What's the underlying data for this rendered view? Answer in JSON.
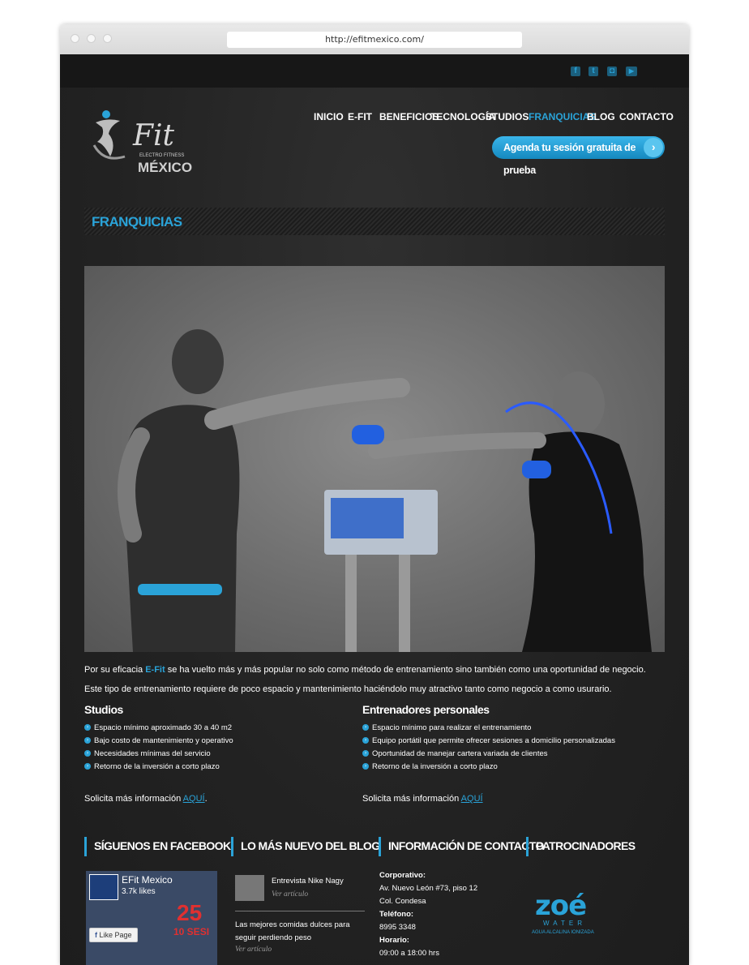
{
  "browser": {
    "url": "http://efitmexico.com/"
  },
  "social": [
    "facebook-icon",
    "twitter-icon",
    "instagram-icon",
    "youtube-icon"
  ],
  "logo": {
    "brand": "Fit",
    "tagline": "ELECTRO FITNESS",
    "country": "MÉXICO"
  },
  "nav": {
    "items": [
      "INICIO",
      "E-FIT",
      "BENEFICIOS",
      "TECNOLOGÍA",
      "STUDIOS",
      "FRANQUICIAS",
      "BLOG",
      "CONTACTO"
    ],
    "active": "FRANQUICIAS"
  },
  "cta": {
    "label": "Agenda tu sesión gratuita de prueba"
  },
  "page": {
    "title": "FRANQUICIAS"
  },
  "intro": {
    "p1_before": "Por su eficacia ",
    "p1_brand": "E-Fit",
    "p1_after": " se ha vuelto más y más popular no solo como método de entrenamiento sino también como una oportunidad de negocio.",
    "p2": "Este tipo de entrenamiento requiere de poco espacio y mantenimiento haciéndolo muy atractivo tanto como negocio a como usurario."
  },
  "studios": {
    "heading": "Studios",
    "items": [
      "Espacio mínimo aproximado 30 a 40 m2",
      "Bajo costo de mantenimiento y operativo",
      "Necesidades mínimas del servicio",
      "Retorno de la inversión a corto plazo"
    ],
    "info_text": "Solicita más información ",
    "info_link": "AQUÍ",
    "info_end": "."
  },
  "trainers": {
    "heading": "Entrenadores personales",
    "items": [
      "Espacio mínimo para realizar el entrenamiento",
      "Equipo portátil que permite ofrecer sesiones a domicilio personalizadas",
      "Oportunidad de manejar cartera variada de clientes",
      "Retorno de la inversión a corto plazo"
    ],
    "info_text": "Solicita más información ",
    "info_link": "AQUÍ"
  },
  "footer": {
    "facebook": {
      "heading": "SÍGUENOS EN FACEBOOK",
      "page_name": "EFit Mexico",
      "likes": "3.7k likes",
      "like_button": "Like Page",
      "promo": "25",
      "promo2": "10 SESI"
    },
    "blog": {
      "heading": "LO MÁS NUEVO DEL BLOG",
      "posts": [
        {
          "title": "Entrevista Nike Nagy",
          "link": "Ver artículo"
        },
        {
          "title": "Las mejores comidas dulces para seguir perdiendo peso",
          "link": "Ver artículo"
        }
      ]
    },
    "contact": {
      "heading": "INFORMACIÓN DE CONTACTO",
      "corp_label": "Corporativo:",
      "address1": "Av. Nuevo León #73, piso 12",
      "address2": "Col. Condesa",
      "phone_label": "Teléfono:",
      "phone": "8995 3348",
      "hours_label": "Horario:",
      "hours": "09:00 a 18:00 hrs"
    },
    "sponsors": {
      "heading": "PATROCINADORES",
      "sponsor_name": "zoé",
      "sponsor_sub": "WATER",
      "sponsor_tag": "AGUA ALCALINA IONIZADA"
    }
  },
  "colors": {
    "accent": "#2aa3d8",
    "background": "#232323"
  }
}
